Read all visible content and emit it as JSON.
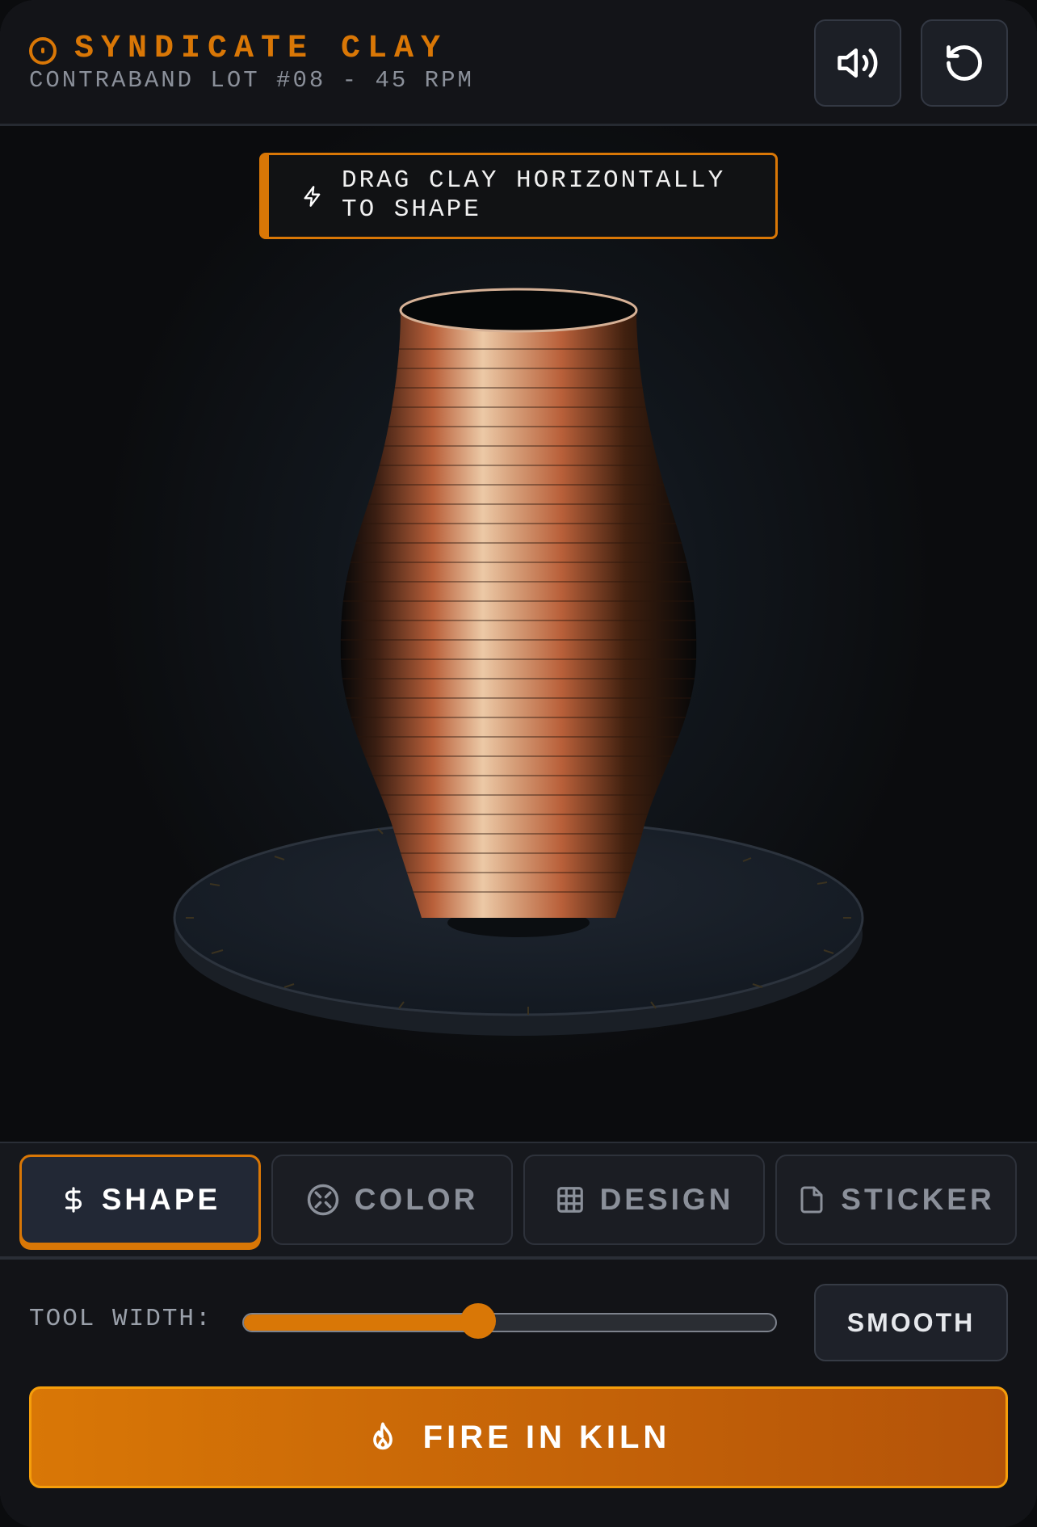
{
  "header": {
    "title": "SYNDICATE CLAY",
    "subtitle": "CONTRABAND LOT #08 - 45 RPM",
    "icons": [
      "target-icon",
      "speaker-icon",
      "reset-icon"
    ]
  },
  "hint": {
    "text": "DRAG CLAY HORIZONTALLY TO SHAPE",
    "icon": "lightning-icon"
  },
  "tabs": [
    {
      "label": "SHAPE",
      "icon": "dollar-icon",
      "active": true
    },
    {
      "label": "COLOR",
      "icon": "palette-icon",
      "active": false
    },
    {
      "label": "DESIGN",
      "icon": "grid-icon",
      "active": false
    },
    {
      "label": "STICKER",
      "icon": "document-icon",
      "active": false
    }
  ],
  "controls": {
    "tool_width_label": "TOOL WIDTH:",
    "tool_width_value": 0.44,
    "smooth_label": "SMOOTH",
    "fire_label": "FIRE IN KILN",
    "fire_icon": "flame-icon"
  },
  "colors": {
    "accent": "#d97706",
    "accent_dark": "#b45309",
    "clay_light": "#ecc9a6",
    "clay_mid": "#b9603a",
    "background": "#121317"
  }
}
